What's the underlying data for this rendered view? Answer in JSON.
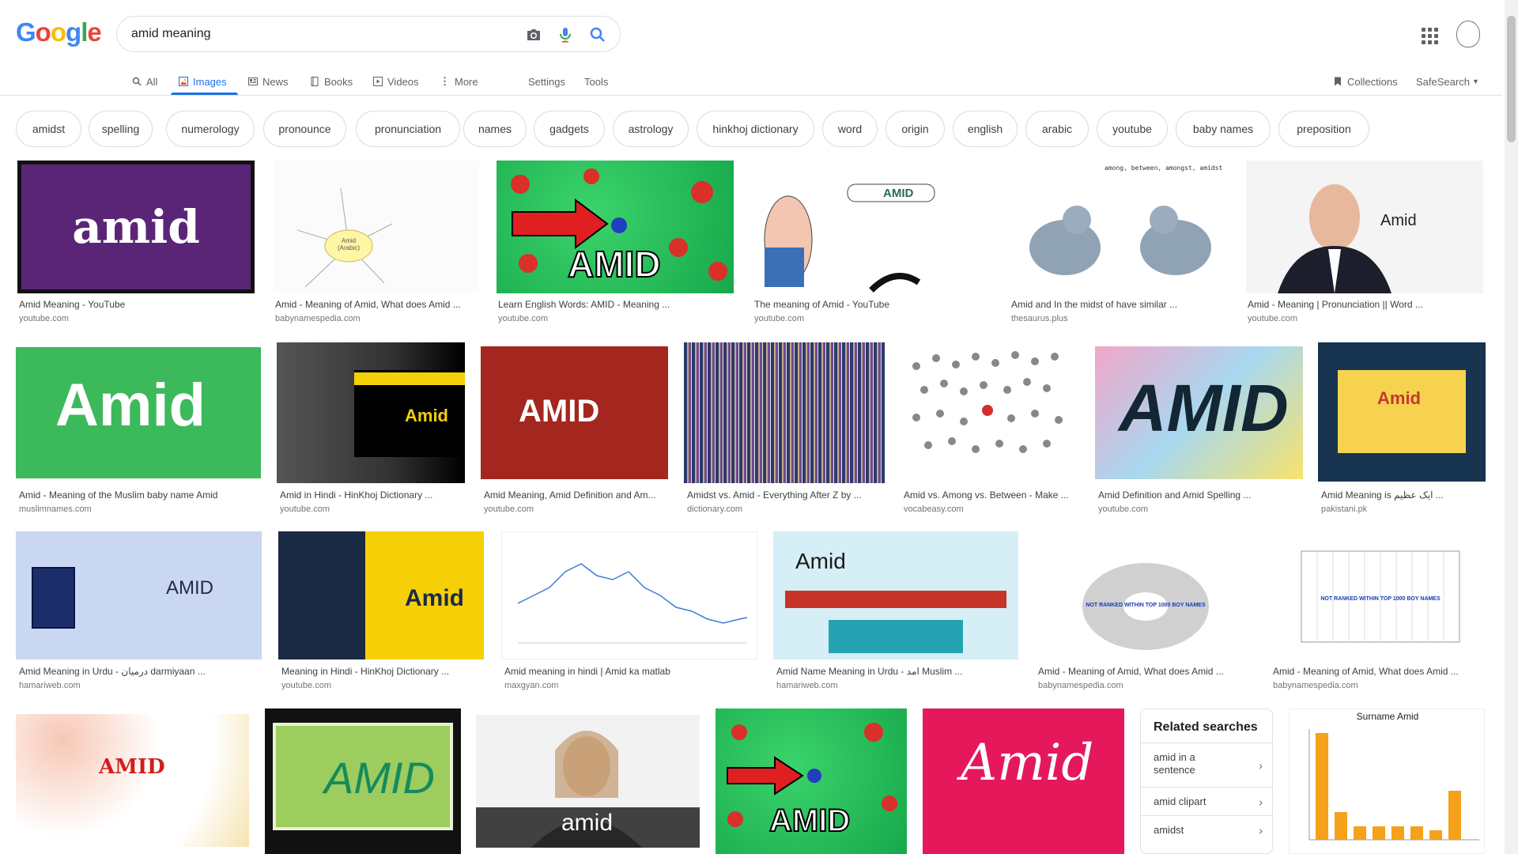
{
  "logo": {
    "letters": [
      "G",
      "o",
      "o",
      "g",
      "l",
      "e"
    ],
    "colors": [
      "#4285f4",
      "#ea4335",
      "#fbbc05",
      "#4285f4",
      "#34a853",
      "#ea4335"
    ]
  },
  "search": {
    "query": "amid meaning"
  },
  "tabs": [
    {
      "label": "All",
      "icon": "search-icon"
    },
    {
      "label": "Images",
      "icon": "image-icon"
    },
    {
      "label": "News",
      "icon": "news-icon"
    },
    {
      "label": "Books",
      "icon": "book-icon"
    },
    {
      "label": "Videos",
      "icon": "video-icon"
    },
    {
      "label": "More",
      "icon": "more-icon"
    },
    {
      "label": "Settings"
    },
    {
      "label": "Tools"
    }
  ],
  "right_tools": {
    "collections": "Collections",
    "safesearch": "SafeSearch"
  },
  "chips": [
    "amidst",
    "spelling",
    "numerology",
    "pronounce",
    "pronunciation",
    "names",
    "gadgets",
    "astrology",
    "hinkhoj dictionary",
    "word",
    "origin",
    "english",
    "arabic",
    "youtube",
    "baby names",
    "preposition"
  ],
  "results": [
    {
      "title": "Amid Meaning - YouTube",
      "source": "youtube.com",
      "text": "amid"
    },
    {
      "title": "Amid - Meaning of Amid, What does Amid ...",
      "source": "babynamespedia.com",
      "text": "Amid (Arabic)"
    },
    {
      "title": "Learn English Words: AMID - Meaning ...",
      "source": "youtube.com",
      "text": "AMID"
    },
    {
      "title": "The meaning of Amid - YouTube",
      "source": "youtube.com",
      "text": "AMID"
    },
    {
      "title": "Amid and In the midst of have similar ...",
      "source": "thesaurus.plus",
      "text": "among, between, amongst, amidst"
    },
    {
      "title": "Amid - Meaning | Pronunciation || Word ...",
      "source": "youtube.com",
      "text": "Amid"
    },
    {
      "title": "Amid - Meaning of the Muslim baby name Amid",
      "source": "muslimnames.com",
      "text": "Amid"
    },
    {
      "title": "Amid in Hindi - HinKhoj Dictionary ...",
      "source": "youtube.com",
      "text": "Amid"
    },
    {
      "title": "Amid Meaning, Amid Definition and Am...",
      "source": "youtube.com",
      "text": "AMID"
    },
    {
      "title": "Amidst vs. Amid - Everything After Z by ...",
      "source": "dictionary.com",
      "text": ""
    },
    {
      "title": "Amid vs. Among vs. Between - Make ...",
      "source": "vocabeasy.com",
      "text": ""
    },
    {
      "title": "Amid Definition and Amid Spelling ...",
      "source": "youtube.com",
      "text": "AMID"
    },
    {
      "title": "Amid Meaning is ایک عظیم ...",
      "source": "pakistani.pk",
      "text": "Amid"
    },
    {
      "title": "Amid Meaning in Urdu - درمیان darmiyaan ...",
      "source": "hamariweb.com",
      "text": "AMID"
    },
    {
      "title": "Meaning in Hindi - HinKhoj Dictionary ...",
      "source": "youtube.com",
      "text": "Amid"
    },
    {
      "title": "Amid meaning in hindi | Amid ka matlab",
      "source": "maxgyan.com",
      "text": ""
    },
    {
      "title": "Amid Name Meaning in Urdu - امد Muslim ...",
      "source": "hamariweb.com",
      "text": "Amid"
    },
    {
      "title": "Amid - Meaning of Amid, What does Amid ...",
      "source": "babynamespedia.com",
      "text": "NOT RANKED WITHIN TOP 1000 BOY NAMES"
    },
    {
      "title": "Amid - Meaning of Amid, What does Amid ...",
      "source": "babynamespedia.com",
      "text": "NOT RANKED WITHIN TOP 1000 BOY NAMES"
    },
    {
      "title": "",
      "source": "",
      "text": "AMID"
    },
    {
      "title": "",
      "source": "",
      "text": "AMID"
    },
    {
      "title": "",
      "source": "",
      "text": "amid"
    },
    {
      "title": "",
      "source": "",
      "text": "AMID"
    },
    {
      "title": "",
      "source": "",
      "text": "Amid"
    },
    {
      "title": "",
      "source": "",
      "text": "Surname Amid"
    }
  ],
  "related": {
    "heading": "Related searches",
    "items": [
      "amid in a sentence",
      "amid clipart",
      "amidst"
    ]
  }
}
